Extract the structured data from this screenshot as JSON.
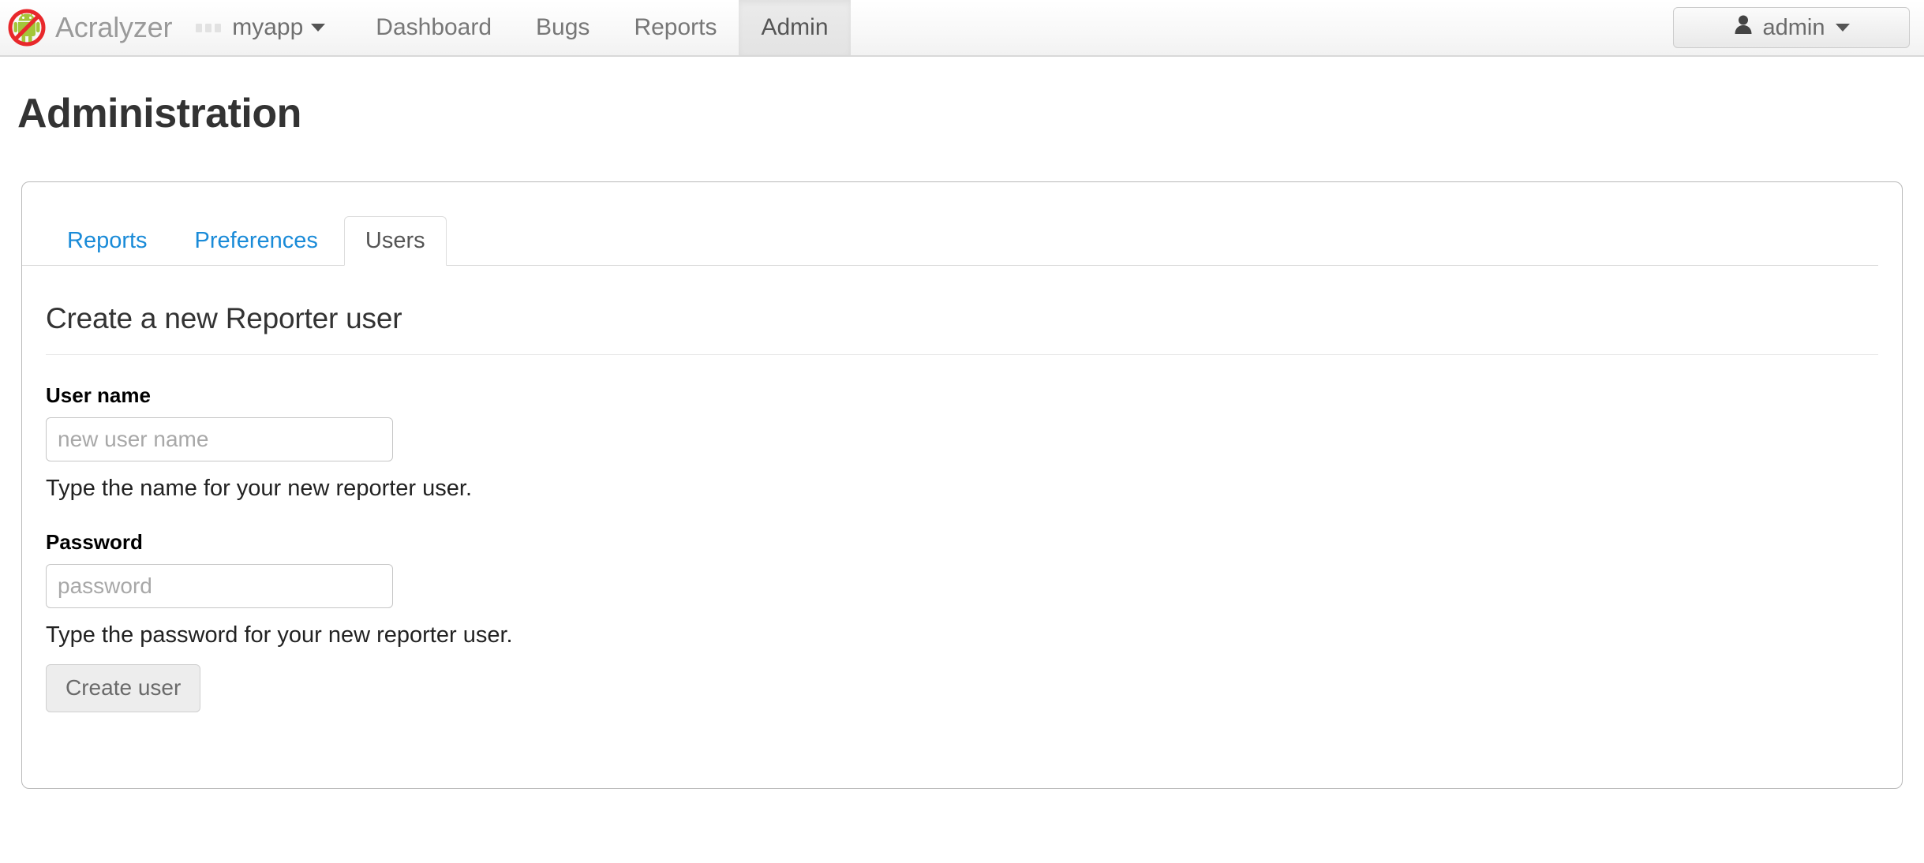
{
  "navbar": {
    "logo_icon": "android-prohibited-icon",
    "brand": "Acralyzer",
    "app_grid_icon": "app-dots-icon",
    "app_selector": {
      "label": "myapp",
      "caret_icon": "caret-down-icon"
    },
    "links": [
      {
        "label": "Dashboard",
        "active": false
      },
      {
        "label": "Bugs",
        "active": false
      },
      {
        "label": "Reports",
        "active": false
      },
      {
        "label": "Admin",
        "active": true
      }
    ],
    "user_menu": {
      "icon": "person-icon",
      "label": "admin",
      "caret_icon": "caret-down-icon"
    }
  },
  "page": {
    "title": "Administration"
  },
  "tabs": [
    {
      "label": "Reports",
      "active": false
    },
    {
      "label": "Preferences",
      "active": false
    },
    {
      "label": "Users",
      "active": true
    }
  ],
  "form": {
    "heading": "Create a new Reporter user",
    "username": {
      "label": "User name",
      "placeholder": "new user name",
      "value": "",
      "help": "Type the name for your new reporter user."
    },
    "password": {
      "label": "Password",
      "placeholder": "password",
      "value": "",
      "help": "Type the password for your new reporter user."
    },
    "submit_label": "Create user"
  },
  "colors": {
    "link_blue": "#1a8bd8",
    "logo_green": "#a4c639",
    "logo_red": "#e8282b",
    "text_dark": "#333333"
  }
}
